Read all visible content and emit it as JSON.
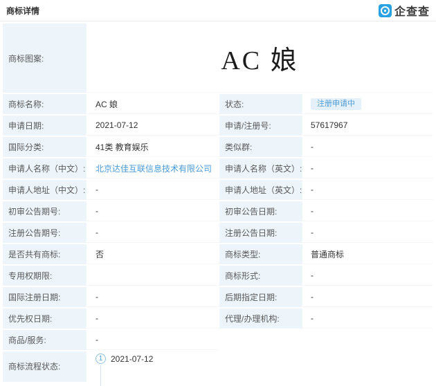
{
  "header": {
    "title": "商标详情",
    "brand_name": "企查查"
  },
  "colors": {
    "brand_blue": "#28a2e2",
    "label_cell_bg": "#edf5fb",
    "link_blue": "#4a9ad8",
    "badge_bg": "#e4f1fb",
    "badge_text": "#4e9ad6"
  },
  "table": {
    "pattern_row": {
      "label": "商标图案:",
      "value": "AC 娘"
    },
    "fields": [
      {
        "label_left": "商标名称:",
        "value_left": "AC 娘",
        "type_left": "text",
        "label_right": "状态:",
        "value_right": "注册申请中",
        "type_right": "badge"
      },
      {
        "label_left": "申请日期:",
        "value_left": "2021-07-12",
        "type_left": "text",
        "label_right": "申请/注册号:",
        "value_right": "57617967",
        "type_right": "text"
      },
      {
        "label_left": "国际分类:",
        "value_left": "41类 教育娱乐",
        "type_left": "text",
        "label_right": "类似群:",
        "value_right": "-",
        "type_right": "text"
      },
      {
        "label_left": "申请人名称（中文）:",
        "value_left": "北京达佳互联信息技术有限公司",
        "type_left": "link",
        "label_right": "申请人名称（英文）:",
        "value_right": "-",
        "type_right": "text"
      },
      {
        "label_left": "申请人地址（中文）:",
        "value_left": "-",
        "type_left": "text",
        "label_right": "申请人地址（英文）:",
        "value_right": "-",
        "type_right": "text"
      },
      {
        "label_left": "初审公告期号:",
        "value_left": "-",
        "type_left": "text",
        "label_right": "初审公告日期:",
        "value_right": "-",
        "type_right": "text"
      },
      {
        "label_left": "注册公告期号:",
        "value_left": "-",
        "type_left": "text",
        "label_right": "注册公告日期:",
        "value_right": "-",
        "type_right": "text"
      },
      {
        "label_left": "是否共有商标:",
        "value_left": "否",
        "type_left": "text",
        "label_right": "商标类型:",
        "value_right": "普通商标",
        "type_right": "text"
      },
      {
        "label_left": "专用权期限:",
        "value_left": "",
        "type_left": "text",
        "label_right": "商标形式:",
        "value_right": "-",
        "type_right": "text"
      },
      {
        "label_left": "国际注册日期:",
        "value_left": "-",
        "type_left": "text",
        "label_right": "后期指定日期:",
        "value_right": "-",
        "type_right": "text"
      },
      {
        "label_left": "优先权日期:",
        "value_left": "-",
        "type_left": "text",
        "label_right": "代理/办理机构:",
        "value_right": "-",
        "type_right": "text"
      },
      {
        "label_left": "商品/服务:",
        "value_left": "-",
        "type_left": "text",
        "label_right": null,
        "value_right": null,
        "type_right": "none"
      }
    ]
  },
  "flow": {
    "label": "商标流程状态:",
    "steps": [
      {
        "number": "1",
        "date": "2021-07-12"
      }
    ]
  }
}
